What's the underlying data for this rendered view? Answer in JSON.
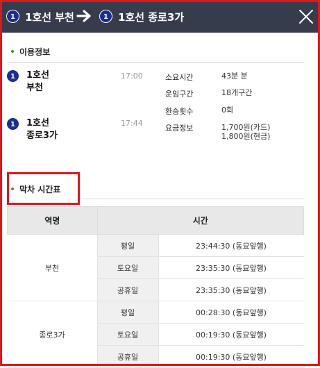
{
  "header": {
    "from_line_badge": "1",
    "from_station": "1호선 부천",
    "to_line_badge": "1",
    "to_station": "1호선 종로3가"
  },
  "info_section": {
    "title": "이용정보",
    "departure": {
      "badge": "1",
      "line": "1호선",
      "station": "부천",
      "time": "17:00"
    },
    "arrival": {
      "badge": "1",
      "line": "1호선",
      "station": "종로3가",
      "time": "17:44"
    },
    "details": [
      {
        "label": "소요시간",
        "value": "43분 분"
      },
      {
        "label": "운임구간",
        "value": "18개구간"
      },
      {
        "label": "환승횟수",
        "value": "0회"
      },
      {
        "label": "요금정보",
        "value": "1,700원(카드)",
        "value2": "1,800원(현금)"
      }
    ]
  },
  "timetable_section": {
    "title": "막차 시간표",
    "col_station": "역명",
    "col_time": "시간",
    "stations": [
      {
        "name": "부천",
        "rows": [
          {
            "day": "평일",
            "time": "23:44:30 (동묘앞행)"
          },
          {
            "day": "토요일",
            "time": "23:35:30 (동묘앞행)"
          },
          {
            "day": "공휴일",
            "time": "23:35:30 (동묘앞행)"
          }
        ]
      },
      {
        "name": "종로3가",
        "rows": [
          {
            "day": "평일",
            "time": "00:28:30 (동묘앞행)"
          },
          {
            "day": "토요일",
            "time": "00:19:30 (동묘앞행)"
          },
          {
            "day": "공휴일",
            "time": "00:19:30 (동묘앞행)"
          }
        ]
      }
    ]
  },
  "colors": {
    "header_bg": "#363c4b",
    "line1": "#1b2f90",
    "accent_red": "#e3151b",
    "dot_green": "#2aa236"
  }
}
